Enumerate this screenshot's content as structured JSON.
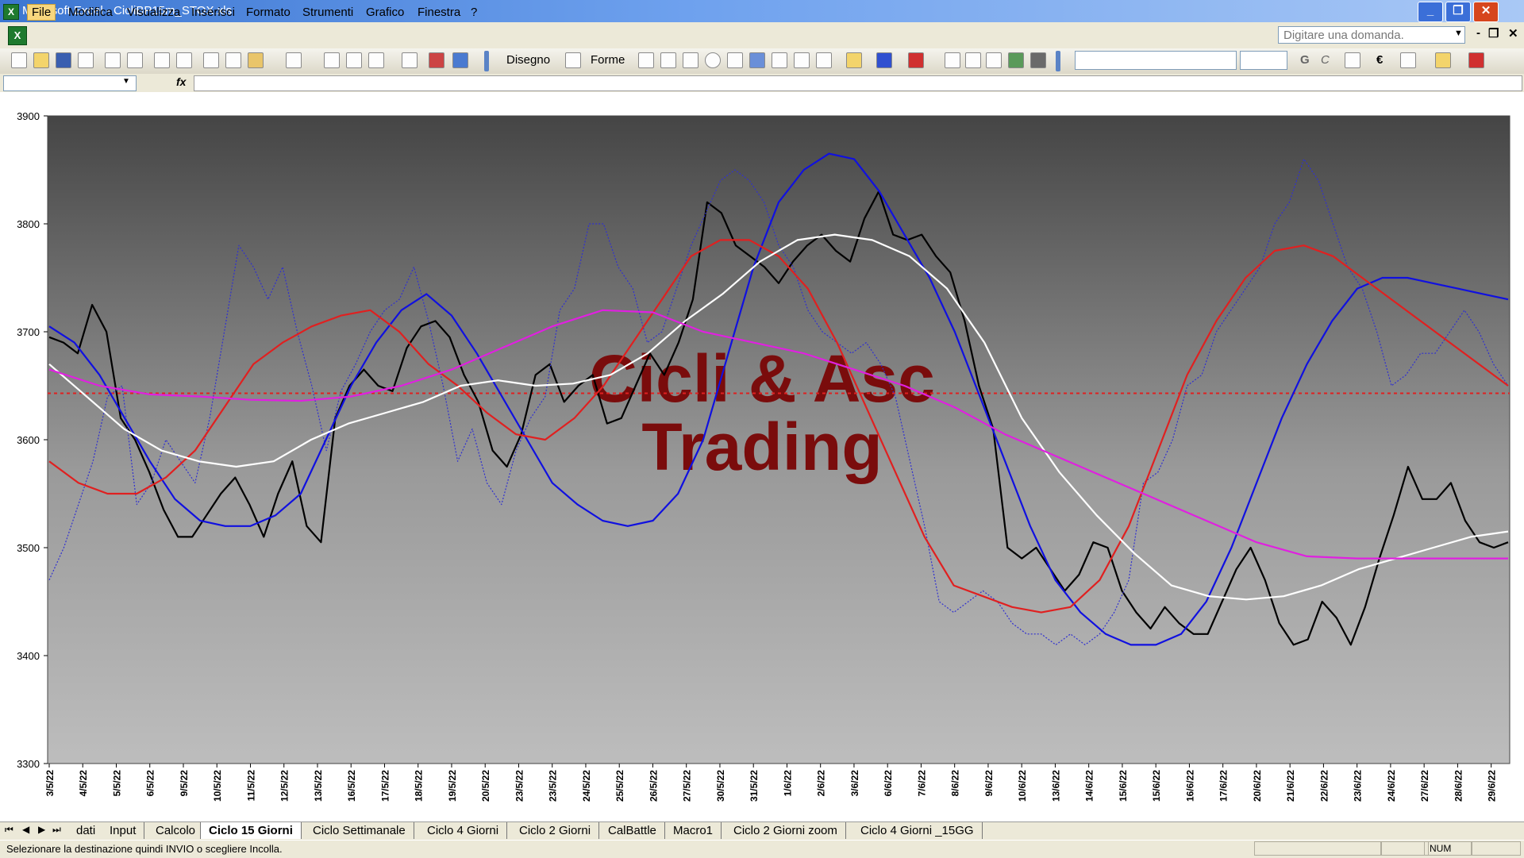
{
  "window": {
    "title": "Microsoft Excel - CicliBP15m_STOX.xls",
    "app_icon": "excel-icon",
    "controls": [
      "_",
      "❐",
      "✕"
    ]
  },
  "menubar": {
    "items": [
      "File",
      "Modifica",
      "Visualizza",
      "Inserisci",
      "Formato",
      "Strumenti",
      "Grafico",
      "Finestra",
      "?"
    ],
    "ask_placeholder": "Digitare una domanda.",
    "doc_controls": [
      "-",
      "❐",
      "✕"
    ]
  },
  "toolbar": {
    "draw_label": "Disegno",
    "shapes_label": "Forme",
    "currency_symbol": "€",
    "font_combo_value": "",
    "size_combo_value": "",
    "bold_label": "G",
    "italic_label": "C"
  },
  "formula_bar": {
    "fx_label": "fx",
    "cell_value": ""
  },
  "chart_data": {
    "type": "line",
    "title": "",
    "xlabel": "",
    "ylabel": "",
    "ylim": [
      3300,
      3900
    ],
    "y_ticks": [
      3300,
      3400,
      3500,
      3600,
      3700,
      3800,
      3900
    ],
    "x_tick_labels": [
      "3/5/22",
      "4/5/22",
      "5/5/22",
      "6/5/22",
      "9/5/22",
      "10/5/22",
      "11/5/22",
      "12/5/22",
      "13/5/22",
      "16/5/22",
      "17/5/22",
      "18/5/22",
      "19/5/22",
      "20/5/22",
      "23/5/22",
      "23/5/22",
      "24/5/22",
      "25/5/22",
      "26/5/22",
      "27/5/22",
      "30/5/22",
      "31/5/22",
      "1/6/22",
      "2/6/22",
      "3/6/22",
      "6/6/22",
      "7/6/22",
      "8/6/22",
      "9/6/22",
      "10/6/22",
      "13/6/22",
      "14/6/22",
      "15/6/22",
      "15/6/22",
      "16/6/22",
      "17/6/22",
      "20/6/22",
      "21/6/22",
      "22/6/22",
      "23/6/22",
      "24/6/22",
      "27/6/22",
      "28/6/22",
      "29/6/22"
    ],
    "watermark": [
      "Cicli & Asc",
      "Trading"
    ],
    "reference_line": {
      "value": 3643,
      "color": "#e02020",
      "style": "dashed"
    },
    "background": "gradient dark-gray top to light-gray bottom",
    "grid": false,
    "legend": "none",
    "series": [
      {
        "color": "#000000",
        "style": "solid",
        "values": [
          3695,
          3690,
          3680,
          3725,
          3700,
          3620,
          3600,
          3570,
          3535,
          3510,
          3510,
          3530,
          3550,
          3565,
          3540,
          3510,
          3550,
          3580,
          3520,
          3505,
          3620,
          3650,
          3665,
          3650,
          3645,
          3685,
          3705,
          3710,
          3695,
          3660,
          3635,
          3590,
          3575,
          3605,
          3660,
          3670,
          3635,
          3650,
          3660,
          3615,
          3620,
          3650,
          3680,
          3660,
          3690,
          3730,
          3820,
          3810,
          3780,
          3770,
          3760,
          3745,
          3765,
          3780,
          3790,
          3775,
          3765,
          3805,
          3830,
          3790,
          3785,
          3790,
          3770,
          3755,
          3710,
          3650,
          3610,
          3500,
          3490,
          3500,
          3480,
          3460,
          3475,
          3505,
          3500,
          3460,
          3440,
          3425,
          3445,
          3430,
          3420,
          3420,
          3450,
          3480,
          3500,
          3470,
          3430,
          3410,
          3415,
          3450,
          3435,
          3410,
          3445,
          3490,
          3530,
          3575,
          3545,
          3545,
          3560,
          3525,
          3505,
          3500,
          3505
        ]
      },
      {
        "color": "#3030d0",
        "style": "dotted",
        "values": [
          3470,
          3500,
          3540,
          3580,
          3640,
          3650,
          3540,
          3560,
          3600,
          3580,
          3560,
          3620,
          3700,
          3780,
          3760,
          3730,
          3760,
          3700,
          3650,
          3590,
          3645,
          3670,
          3700,
          3720,
          3730,
          3760,
          3710,
          3650,
          3580,
          3610,
          3560,
          3540,
          3590,
          3620,
          3640,
          3720,
          3740,
          3800,
          3800,
          3760,
          3740,
          3690,
          3700,
          3740,
          3780,
          3810,
          3840,
          3850,
          3840,
          3820,
          3780,
          3760,
          3720,
          3700,
          3690,
          3680,
          3690,
          3670,
          3640,
          3580,
          3520,
          3450,
          3440,
          3450,
          3460,
          3450,
          3430,
          3420,
          3420,
          3410,
          3420,
          3410,
          3420,
          3440,
          3470,
          3560,
          3570,
          3600,
          3650,
          3660,
          3700,
          3720,
          3740,
          3760,
          3800,
          3820,
          3860,
          3840,
          3800,
          3760,
          3740,
          3700,
          3650,
          3660,
          3680,
          3680,
          3700,
          3720,
          3700,
          3670,
          3650
        ]
      },
      {
        "color": "#1010e0",
        "style": "solid",
        "values": [
          3705,
          3690,
          3660,
          3620,
          3580,
          3545,
          3525,
          3520,
          3520,
          3530,
          3550,
          3600,
          3650,
          3690,
          3720,
          3735,
          3715,
          3680,
          3640,
          3600,
          3560,
          3540,
          3525,
          3520,
          3525,
          3550,
          3600,
          3680,
          3760,
          3820,
          3850,
          3865,
          3860,
          3830,
          3790,
          3750,
          3700,
          3640,
          3580,
          3520,
          3470,
          3440,
          3420,
          3410,
          3410,
          3420,
          3450,
          3500,
          3560,
          3620,
          3670,
          3710,
          3740,
          3750,
          3750,
          3745,
          3740,
          3735,
          3730
        ]
      },
      {
        "color": "#e02020",
        "style": "solid",
        "values": [
          3580,
          3560,
          3550,
          3550,
          3565,
          3590,
          3630,
          3670,
          3690,
          3705,
          3715,
          3720,
          3700,
          3670,
          3650,
          3625,
          3605,
          3600,
          3620,
          3650,
          3690,
          3730,
          3770,
          3785,
          3785,
          3770,
          3740,
          3690,
          3630,
          3570,
          3510,
          3465,
          3455,
          3445,
          3440,
          3445,
          3470,
          3520,
          3590,
          3660,
          3710,
          3750,
          3775,
          3780,
          3770,
          3750,
          3730,
          3710,
          3690,
          3670,
          3650
        ]
      },
      {
        "color": "#ffffff",
        "style": "solid",
        "values": [
          3670,
          3640,
          3610,
          3590,
          3580,
          3575,
          3580,
          3600,
          3615,
          3625,
          3635,
          3650,
          3655,
          3650,
          3652,
          3660,
          3680,
          3710,
          3735,
          3765,
          3785,
          3790,
          3785,
          3770,
          3740,
          3690,
          3620,
          3570,
          3530,
          3495,
          3465,
          3455,
          3452,
          3455,
          3465,
          3480,
          3490,
          3500,
          3510,
          3515
        ]
      },
      {
        "color": "#e020e0",
        "style": "solid",
        "values": [
          3665,
          3650,
          3642,
          3640,
          3637,
          3636,
          3640,
          3650,
          3665,
          3685,
          3705,
          3720,
          3718,
          3700,
          3690,
          3680,
          3665,
          3650,
          3630,
          3605,
          3585,
          3565,
          3545,
          3525,
          3505,
          3492,
          3490,
          3490,
          3490,
          3490
        ]
      }
    ]
  },
  "sheet_tabs": {
    "nav": [
      "⏮",
      "◀",
      "▶",
      "⏭"
    ],
    "tabs": [
      "dati",
      "Input",
      "Calcolo",
      "Ciclo 15 Giorni",
      "Ciclo Settimanale",
      "Ciclo 4 Giorni",
      "Ciclo 2 Giorni",
      "CalBattle",
      "Macro1",
      "Ciclo 2 Giorni zoom",
      "Ciclo 4 Giorni _15GG"
    ],
    "active": "Ciclo 15 Giorni"
  },
  "statusbar": {
    "message": "Selezionare la destinazione quindi INVIO o scegliere Incolla.",
    "num_indicator": "NUM"
  }
}
